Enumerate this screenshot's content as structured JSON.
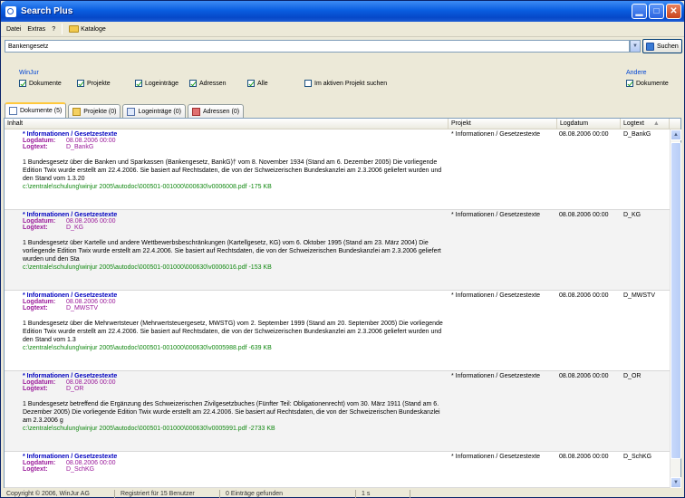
{
  "window": {
    "title": "Search Plus",
    "buttons": {
      "minimize": "▁",
      "maximize": "□",
      "close": "✕"
    }
  },
  "menu": {
    "datei": "Datei",
    "extras": "Extras",
    "help": "?",
    "kataloge": "Kataloge"
  },
  "search": {
    "value": "Bankengesetz",
    "button": "Suchen"
  },
  "filters": {
    "group_label": "WinJur",
    "items": [
      {
        "label": "Dokumente",
        "checked": true
      },
      {
        "label": "Projekte",
        "checked": true
      },
      {
        "label": "Logeinträge",
        "checked": true
      },
      {
        "label": "Adressen",
        "checked": true
      },
      {
        "label": "Alle",
        "checked": true
      }
    ],
    "active_project": {
      "label": "Im aktiven Projekt suchen",
      "checked": false
    },
    "andere_label": "Andere",
    "andere_item": {
      "label": "Dokumente",
      "checked": true
    }
  },
  "tabs": [
    {
      "label": "Dokumente (5)",
      "icon": "document-icon"
    },
    {
      "label": "Projekte (0)",
      "icon": "folder-icon"
    },
    {
      "label": "Logeinträge (0)",
      "icon": "log-icon"
    },
    {
      "label": "Adressen (0)",
      "icon": "address-icon"
    }
  ],
  "table": {
    "headers": {
      "inhalt": "Inhalt",
      "projekt": "Projekt",
      "logdatum": "Logdatum",
      "logtext": "Logtext",
      "sort": "▲"
    },
    "meta_labels": {
      "logdatum": "Logdatum:",
      "logtext": "Logtext:"
    },
    "rows": [
      {
        "title": "* Informationen / Gesetzestexte",
        "logdatum": "08.08.2006 00:00",
        "logtext": "D_BankG",
        "desc": "1 Bundesgesetz über die Banken und Sparkassen (Bankengesetz, BankG)† vom 8. November 1934 (Stand am 6. Dezember 2005) Die vorliegende Edition Twix wurde erstellt am 22.4.2006. Sie basiert auf Rechtsdaten, die von der Schweizerischen Bundeskanzlei am 2.3.2006 geliefert wurden und den Stand vom 1.3.20",
        "path": "c:\\zentrale\\schulung\\winjur 2005\\autodoc\\000501-001000\\000630\\v0006008.pdf -175 KB",
        "projekt": "* Informationen / Gesetzestexte",
        "date": "08.08.2006 00:00",
        "log": "D_BankG"
      },
      {
        "title": "* Informationen / Gesetzestexte",
        "logdatum": "08.08.2006 00:00",
        "logtext": "D_KG",
        "desc": "1 Bundesgesetz über Kartelle und andere Wettbewerbsbeschränkungen (Kartellgesetz, KG) vom 6. Oktober 1995 (Stand am 23. März 2004) Die vorliegende Edition Twix wurde erstellt am 22.4.2006. Sie basiert auf Rechtsdaten, die von der Schweizerischen Bundeskanzlei am 2.3.2006 geliefert wurden und den Sta",
        "path": "c:\\zentrale\\schulung\\winjur 2005\\autodoc\\000501-001000\\000630\\v0006016.pdf -153 KB",
        "projekt": "* Informationen / Gesetzestexte",
        "date": "08.08.2006 00:00",
        "log": "D_KG"
      },
      {
        "title": "* Informationen / Gesetzestexte",
        "logdatum": "08.08.2006 00:00",
        "logtext": "D_MWSTV",
        "desc": "1 Bundesgesetz über die Mehrwertsteuer (Mehrwertsteuergesetz, MWSTG) vom 2. September 1999 (Stand am 20. September 2005) Die vorliegende Edition Twix wurde erstellt am 22.4.2006. Sie basiert auf Rechtsdaten, die von der Schweizerischen Bundeskanzlei am 2.3.2006 geliefert wurden und den Stand vom 1.3",
        "path": "c:\\zentrale\\schulung\\winjur 2005\\autodoc\\000501-001000\\000630\\v0005988.pdf -639 KB",
        "projekt": "* Informationen / Gesetzestexte",
        "date": "08.08.2006 00:00",
        "log": "D_MWSTV"
      },
      {
        "title": "* Informationen / Gesetzestexte",
        "logdatum": "08.08.2006 00:00",
        "logtext": "D_OR",
        "desc": "1 Bundesgesetz betreffend die Ergänzung des Schweizerischen Zivilgesetzbuches (Fünfter Teil: Obligationenrecht) vom 30. März 1911 (Stand am 6. Dezember 2005) Die vorliegende Edition Twix wurde erstellt am 22.4.2006. Sie basiert auf Rechtsdaten, die von der Schweizerischen Bundeskanzlei am 2.3.2006 g",
        "path": "c:\\zentrale\\schulung\\winjur 2005\\autodoc\\000501-001000\\000630\\v0005991.pdf -2733 KB",
        "projekt": "* Informationen / Gesetzestexte",
        "date": "08.08.2006 00:00",
        "log": "D_OR"
      },
      {
        "title": "* Informationen / Gesetzestexte",
        "logdatum": "08.08.2006 00:00",
        "logtext": "D_SchKG",
        "desc": "",
        "path": "",
        "projekt": "* Informationen / Gesetzestexte",
        "date": "08.08.2006 00:00",
        "log": "D_SchKG"
      }
    ]
  },
  "status": {
    "copyright": "Copyright © 2006, WinJur AG",
    "license": "Registriert für 15 Benutzer",
    "found": "0 Einträge gefunden",
    "time": "1 s"
  }
}
